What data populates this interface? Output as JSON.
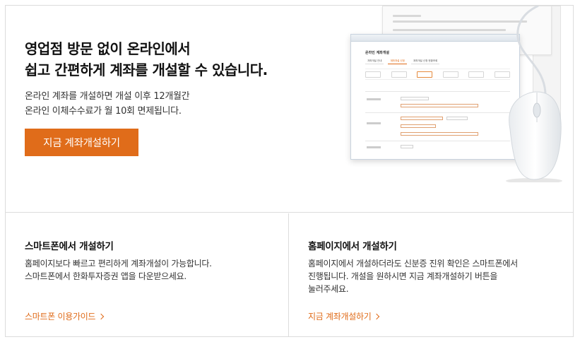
{
  "hero": {
    "title_line1": "영업점 방문 없이 온라인에서",
    "title_line2": "쉽고 간편하게 계좌를 개설할 수 있습니다.",
    "desc_line1": "온라인 계좌를 개설하면 개설 이후 12개월간",
    "desc_line2": "온라인 이체수수료가 월 10회 면제됩니다.",
    "cta_label": "지금 계좌개설하기"
  },
  "illustration": {
    "window_title": "온라인 계좌개설",
    "tabs": [
      "개좌개설 안내",
      "계좌개설 신청",
      "계좌개설 신청 현황조회"
    ],
    "active_tab": 1,
    "steps": 6,
    "active_step": 3,
    "icons": [
      "document-form-icon",
      "mouse-icon"
    ]
  },
  "cards": [
    {
      "title": "스마트폰에서 개설하기",
      "desc_line1": "홈페이지보다 빠르고 편리하게 계좌개설이 가능합니다.",
      "desc_line2": "스마트폰에서 한화투자증권 앱을 다운받으세요.",
      "desc_line3": "",
      "link_label": "스마트폰 이용가이드"
    },
    {
      "title": "홈페이지에서 개설하기",
      "desc_line1": "홈페이지에서 개설하더라도 신분증 진위 확인은 스마트폰에서",
      "desc_line2": "진행됩니다. 개설을 원하시면 지금 계좌개설하기 버튼을",
      "desc_line3": "눌러주세요.",
      "link_label": "지금 계좌개설하기"
    }
  ],
  "colors": {
    "accent": "#e06c1a",
    "border": "#dcdcdc",
    "text": "#222222"
  }
}
